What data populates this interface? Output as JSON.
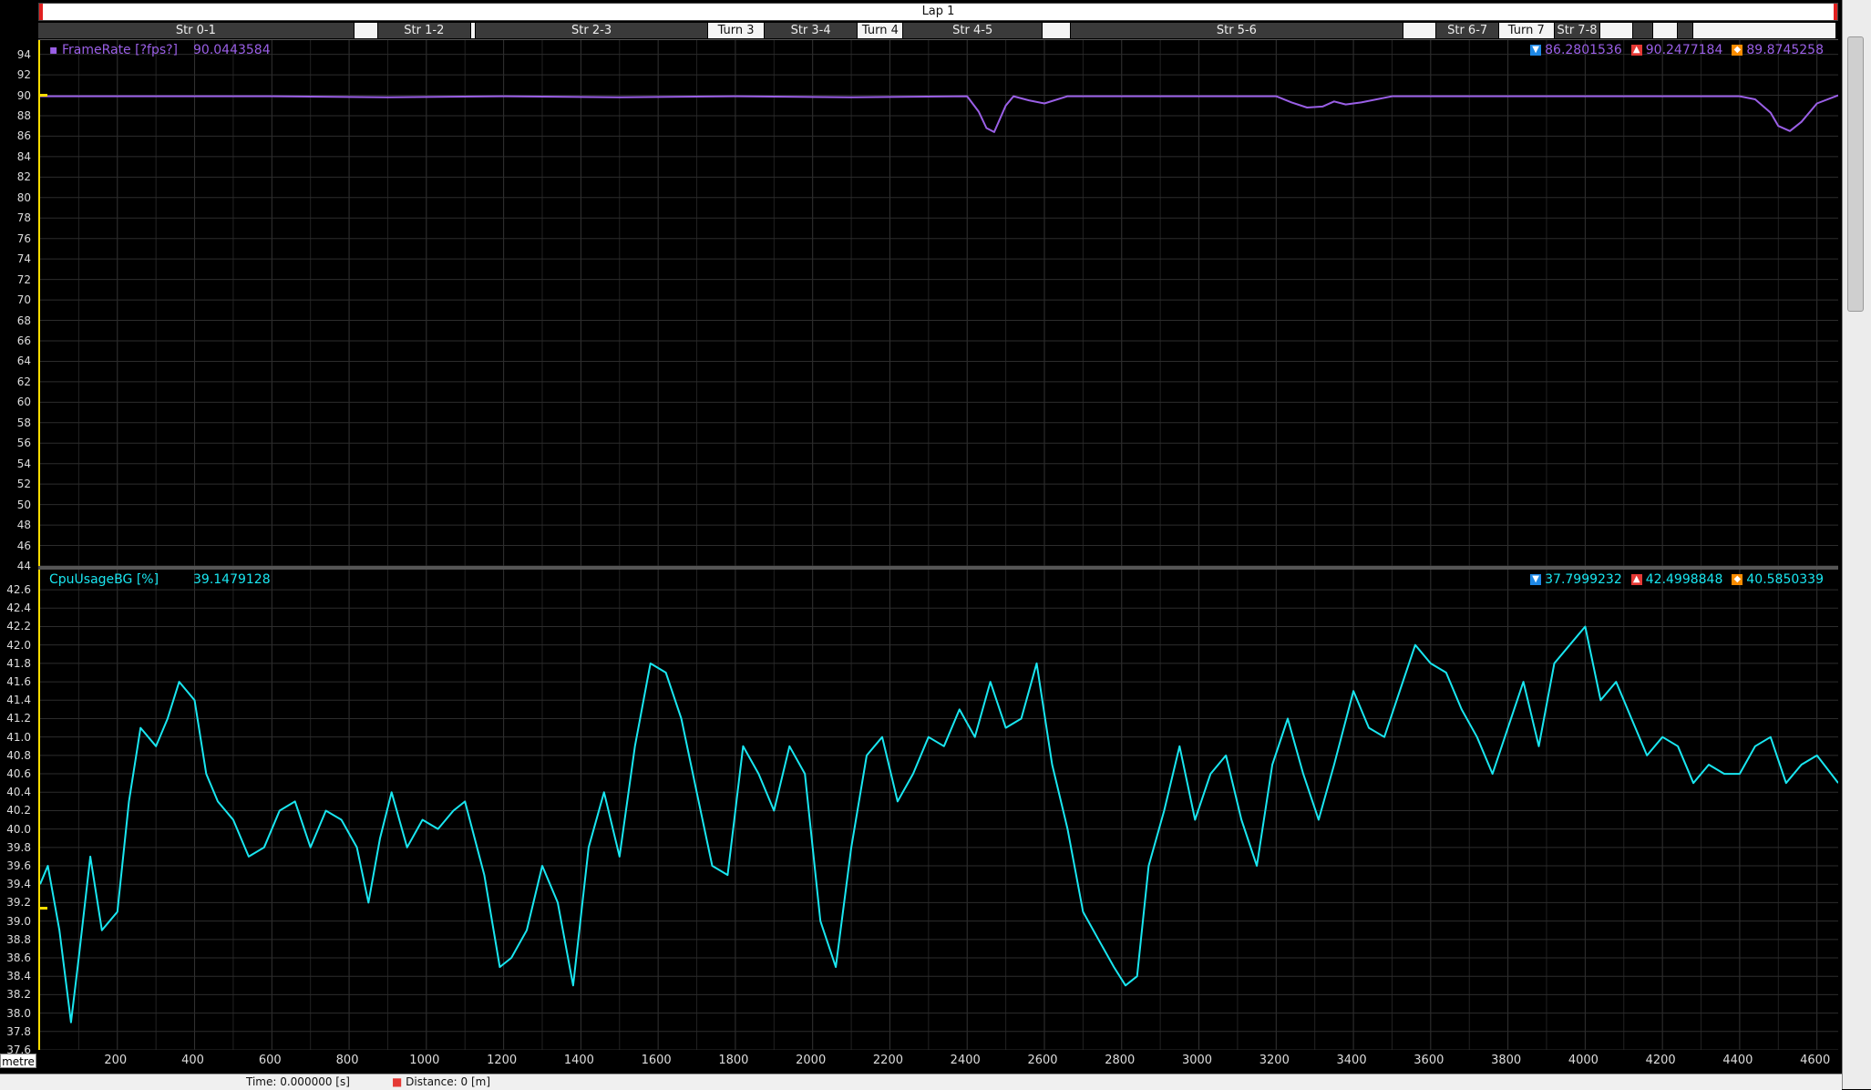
{
  "lap": {
    "label": "Lap 1"
  },
  "segments": [
    {
      "label": "Str 0-1",
      "start": 0,
      "end": 818,
      "style": "dark"
    },
    {
      "label": "",
      "start": 818,
      "end": 880,
      "style": "light"
    },
    {
      "label": "Str 1-2",
      "start": 880,
      "end": 1120,
      "style": "dark"
    },
    {
      "label": "",
      "start": 1120,
      "end": 1132,
      "style": "light"
    },
    {
      "label": "Str 2-3",
      "start": 1132,
      "end": 1735,
      "style": "dark"
    },
    {
      "label": "Turn 3",
      "start": 1735,
      "end": 1880,
      "style": "light"
    },
    {
      "label": "Str 3-4",
      "start": 1880,
      "end": 2122,
      "style": "dark"
    },
    {
      "label": "Turn 4",
      "start": 2122,
      "end": 2240,
      "style": "light"
    },
    {
      "label": "Str 4-5",
      "start": 2240,
      "end": 2600,
      "style": "dark"
    },
    {
      "label": "",
      "start": 2600,
      "end": 2672,
      "style": "light"
    },
    {
      "label": "Str 5-6",
      "start": 2672,
      "end": 3535,
      "style": "dark"
    },
    {
      "label": "",
      "start": 3535,
      "end": 3620,
      "style": "light"
    },
    {
      "label": "Str 6-7",
      "start": 3620,
      "end": 3782,
      "style": "dark"
    },
    {
      "label": "Turn 7",
      "start": 3782,
      "end": 3925,
      "style": "light"
    },
    {
      "label": "Str 7-8",
      "start": 3925,
      "end": 4045,
      "style": "dark"
    },
    {
      "label": "",
      "start": 4045,
      "end": 4130,
      "style": "light"
    },
    {
      "label": "",
      "start": 4130,
      "end": 4180,
      "style": "dark"
    },
    {
      "label": "",
      "start": 4180,
      "end": 4245,
      "style": "light"
    },
    {
      "label": "",
      "start": 4245,
      "end": 4285,
      "style": "dark"
    },
    {
      "label": "",
      "start": 4285,
      "end": 4655,
      "style": "light"
    }
  ],
  "colors": {
    "framerate": "#9a5fe6",
    "cpu": "#19e6f0",
    "accent": "#ffdd00",
    "min": "#1e88e5",
    "max": "#e53935",
    "avg": "#fb8c00"
  },
  "panels": {
    "framerate": {
      "title": "FrameRate [?fps?]",
      "value": "90.0443584",
      "min": "86.2801536",
      "max": "90.2477184",
      "avg": "89.8745258",
      "yticks": [
        "94",
        "92",
        "90",
        "88",
        "86",
        "84",
        "82",
        "80",
        "78",
        "76",
        "74",
        "72",
        "70",
        "68",
        "66",
        "64",
        "62",
        "60",
        "58",
        "56",
        "54",
        "52",
        "50",
        "48",
        "46",
        "44"
      ]
    },
    "cpu": {
      "title": "CpuUsageBG [%]",
      "value": "39.1479128",
      "min": "37.7999232",
      "max": "42.4998848",
      "avg": "40.5850339",
      "yticks": [
        "42.6",
        "42.4",
        "42.2",
        "42.0",
        "41.8",
        "41.6",
        "41.4",
        "41.2",
        "41.0",
        "40.8",
        "40.6",
        "40.4",
        "40.2",
        "40.0",
        "39.8",
        "39.6",
        "39.4",
        "39.2",
        "39.0",
        "38.8",
        "38.6",
        "38.4",
        "38.2",
        "38.0",
        "37.8",
        "37.6"
      ]
    }
  },
  "xaxis": {
    "unit": "metre",
    "ticks": [
      "200",
      "400",
      "600",
      "800",
      "1000",
      "1200",
      "1400",
      "1600",
      "1800",
      "2000",
      "2200",
      "2400",
      "2600",
      "2800",
      "3000",
      "3200",
      "3400",
      "3600",
      "3800",
      "4000",
      "4200",
      "4400",
      "4600"
    ]
  },
  "status": {
    "time": "Time: 0.000000 [s]",
    "distance": "Distance: 0 [m]"
  },
  "chart_data": [
    {
      "type": "line",
      "title": "FrameRate [?fps?]",
      "xlabel": "metre",
      "xlim": [
        0,
        4655
      ],
      "ylim": [
        44,
        94.5
      ],
      "grid": true,
      "series": [
        {
          "name": "FrameRate [?fps?]",
          "x": [
            0,
            300,
            600,
            900,
            1200,
            1500,
            1800,
            2100,
            2400,
            2430,
            2450,
            2470,
            2500,
            2520,
            2560,
            2600,
            2660,
            2900,
            3200,
            3240,
            3280,
            3320,
            3350,
            3380,
            3420,
            3500,
            3800,
            4100,
            4400,
            4440,
            4480,
            4500,
            4530,
            4560,
            4600,
            4655
          ],
          "values": [
            89.9,
            89.9,
            89.9,
            89.8,
            89.9,
            89.8,
            89.9,
            89.8,
            89.9,
            88.4,
            86.8,
            86.4,
            89.0,
            89.9,
            89.5,
            89.2,
            89.9,
            89.9,
            89.9,
            89.3,
            88.8,
            88.9,
            89.4,
            89.1,
            89.3,
            89.9,
            89.9,
            89.9,
            89.9,
            89.6,
            88.3,
            87.0,
            86.5,
            87.4,
            89.2,
            90.0
          ]
        }
      ]
    },
    {
      "type": "line",
      "title": "CpuUsageBG [%]",
      "xlabel": "metre",
      "xlim": [
        0,
        4655
      ],
      "ylim": [
        37.6,
        42.7
      ],
      "grid": true,
      "series": [
        {
          "name": "CpuUsageBG [%]",
          "x": [
            0,
            20,
            50,
            80,
            100,
            130,
            160,
            200,
            230,
            260,
            300,
            330,
            360,
            400,
            430,
            460,
            500,
            540,
            580,
            620,
            660,
            700,
            740,
            780,
            820,
            850,
            880,
            910,
            950,
            990,
            1030,
            1070,
            1100,
            1150,
            1190,
            1220,
            1260,
            1300,
            1340,
            1380,
            1420,
            1460,
            1500,
            1540,
            1580,
            1620,
            1660,
            1700,
            1740,
            1780,
            1820,
            1860,
            1900,
            1940,
            1980,
            2020,
            2060,
            2100,
            2140,
            2180,
            2220,
            2260,
            2300,
            2340,
            2380,
            2420,
            2460,
            2500,
            2540,
            2580,
            2620,
            2660,
            2700,
            2740,
            2780,
            2810,
            2840,
            2870,
            2910,
            2950,
            2990,
            3030,
            3070,
            3110,
            3150,
            3190,
            3230,
            3270,
            3310,
            3350,
            3400,
            3440,
            3480,
            3520,
            3560,
            3600,
            3640,
            3680,
            3720,
            3760,
            3800,
            3840,
            3880,
            3920,
            3960,
            4000,
            4040,
            4080,
            4120,
            4160,
            4200,
            4240,
            4280,
            4320,
            4360,
            4400,
            4440,
            4480,
            4520,
            4560,
            4600,
            4655
          ],
          "values": [
            39.4,
            39.6,
            38.9,
            37.9,
            38.6,
            39.7,
            38.9,
            39.1,
            40.3,
            41.1,
            40.9,
            41.2,
            41.6,
            41.4,
            40.6,
            40.3,
            40.1,
            39.7,
            39.8,
            40.2,
            40.3,
            39.8,
            40.2,
            40.1,
            39.8,
            39.2,
            39.9,
            40.4,
            39.8,
            40.1,
            40.0,
            40.2,
            40.3,
            39.5,
            38.5,
            38.6,
            38.9,
            39.6,
            39.2,
            38.3,
            39.8,
            40.4,
            39.7,
            40.9,
            41.8,
            41.7,
            41.2,
            40.4,
            39.6,
            39.5,
            40.9,
            40.6,
            40.2,
            40.9,
            40.6,
            39.0,
            38.5,
            39.8,
            40.8,
            41.0,
            40.3,
            40.6,
            41.0,
            40.9,
            41.3,
            41.0,
            41.6,
            41.1,
            41.2,
            41.8,
            40.7,
            40.0,
            39.1,
            38.8,
            38.5,
            38.3,
            38.4,
            39.6,
            40.2,
            40.9,
            40.1,
            40.6,
            40.8,
            40.1,
            39.6,
            40.7,
            41.2,
            40.6,
            40.1,
            40.7,
            41.5,
            41.1,
            41.0,
            41.5,
            42.0,
            41.8,
            41.7,
            41.3,
            41.0,
            40.6,
            41.1,
            41.6,
            40.9,
            41.8,
            42.0,
            42.2,
            41.4,
            41.6,
            41.2,
            40.8,
            41.0,
            40.9,
            40.5,
            40.7,
            40.6,
            40.6,
            40.9,
            41.0,
            40.5,
            40.7,
            40.8,
            40.5
          ]
        }
      ]
    }
  ]
}
